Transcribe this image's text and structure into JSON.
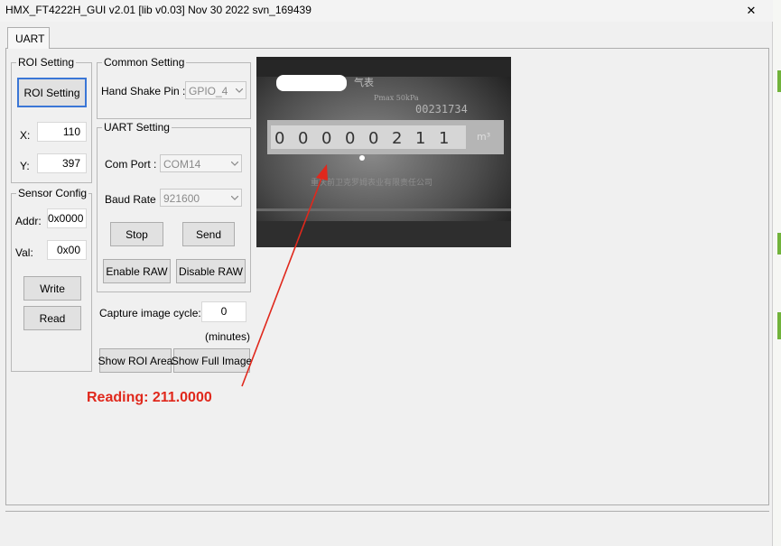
{
  "window": {
    "title": "HMX_FT4222H_GUI v2.01 [lib v0.03] Nov 30 2022 svn_169439",
    "close_glyph": "✕"
  },
  "tabs": [
    {
      "label": "UART"
    }
  ],
  "roi_setting": {
    "group_label": "ROI Setting",
    "button_label": "ROI Setting",
    "x_label": "X:",
    "x_value": "110",
    "y_label": "Y:",
    "y_value": "397"
  },
  "sensor_config": {
    "group_label": "Sensor Config",
    "addr_label": "Addr:",
    "addr_value": "0x0000",
    "val_label": "Val:",
    "val_value": "0x00",
    "write_label": "Write",
    "read_label": "Read"
  },
  "common_setting": {
    "group_label": "Common Setting",
    "handshake_label": "Hand Shake Pin :",
    "handshake_value": "GPIO_4"
  },
  "uart_setting": {
    "group_label": "UART Setting",
    "com_port_label": "Com Port :",
    "com_port_value": "COM14",
    "baud_rate_label": "Baud Rate",
    "baud_rate_value": "921600",
    "stop_label": "Stop",
    "send_label": "Send",
    "enable_raw_label": "Enable RAW",
    "disable_raw_label": "Disable RAW"
  },
  "capture": {
    "label": "Capture image cycle:",
    "value": "0",
    "units": "(minutes)",
    "show_roi_label": "Show ROI Area",
    "show_full_label": "Show Full Image"
  },
  "meter_image": {
    "brand_text": "气表",
    "pressure_text": "Pmax 50kPa",
    "serial_text": "00231734",
    "digits": [
      "0",
      "0",
      "0",
      "0",
      "0",
      "2",
      "1",
      "1"
    ],
    "unit_text": "m³",
    "company_text": "重庆前卫克罗姆表业有限责任公司"
  },
  "annotation": {
    "reading_text": "Reading: 211.0000",
    "color": "#e0281c"
  },
  "colors": {
    "window_bg": "#f0f0f0",
    "default_button_border": "#3a76d6",
    "accent_green": "#71b33b"
  }
}
